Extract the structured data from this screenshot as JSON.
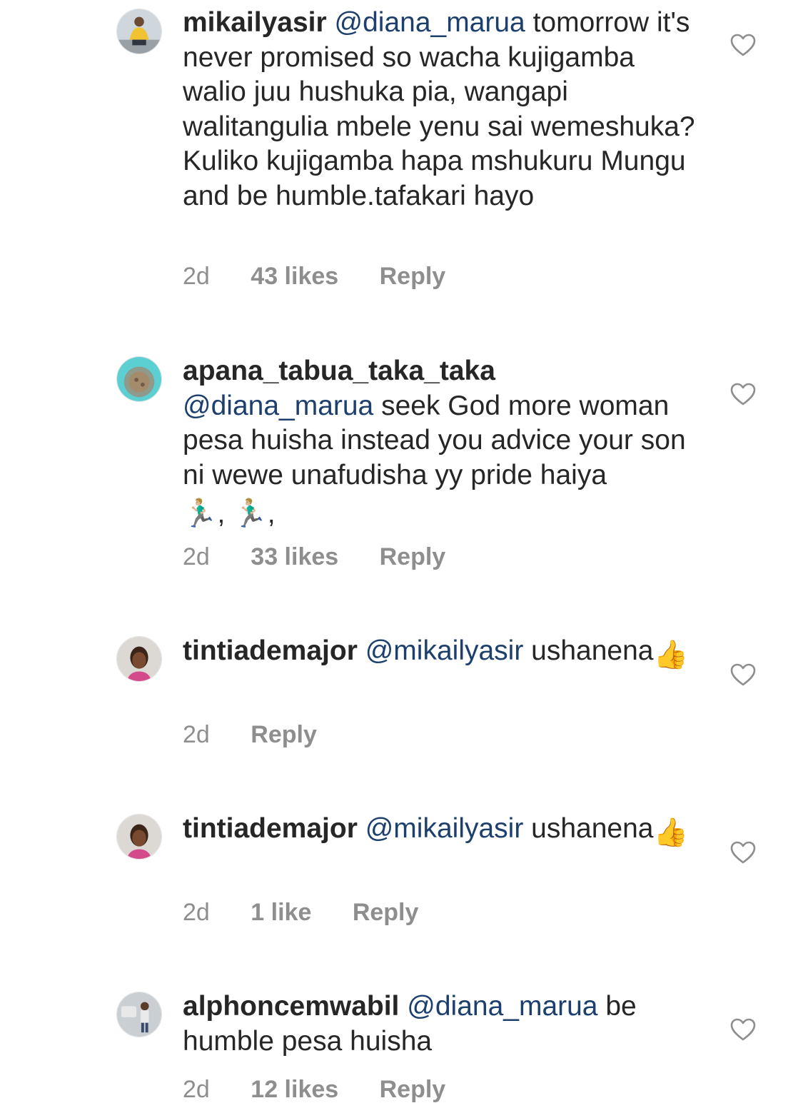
{
  "colors": {
    "text": "#262626",
    "mention": "#1c3f6e",
    "meta": "#8e8e8e"
  },
  "comments": [
    {
      "username": "mikailyasir",
      "mention": "@diana_marua",
      "text_after": " tomorrow it's never promised so wacha kujigamba walio juu hushuka pia, wangapi walitangulia mbele yenu sai wemeshuka? Kuliko kujigamba hapa  mshukuru Mungu and be humble.tafakari hayo",
      "time": "2d",
      "likes": "43 likes",
      "reply": "Reply",
      "avatar_icon": "profile-photo"
    },
    {
      "username": "apana_tabua_taka_taka",
      "mention": "@diana_marua",
      "text_after": " seek God more woman pesa huisha instead you advice your son ni wewe unafudisha yy pride haiya",
      "emoji": "🏃🏼‍♂️, 🏃🏼‍♂️,",
      "time": "2d",
      "likes": "33 likes",
      "reply": "Reply",
      "avatar_icon": "profile-photo"
    },
    {
      "username": "tintiademajor",
      "mention": "@mikailyasir",
      "text_after": " ushanena",
      "emoji": "👍",
      "time": "2d",
      "reply": "Reply",
      "avatar_icon": "profile-photo"
    },
    {
      "username": "tintiademajor",
      "mention": "@mikailyasir",
      "text_after": " ushanena",
      "emoji": "👍",
      "time": "2d",
      "likes": "1 like",
      "reply": "Reply",
      "avatar_icon": "profile-photo"
    },
    {
      "username": "alphoncemwabil",
      "mention": "@diana_marua",
      "text_after": " be humble pesa huisha",
      "time": "2d",
      "likes": "12 likes",
      "reply": "Reply",
      "avatar_icon": "profile-photo"
    }
  ],
  "like_icon": "heart-outline-icon"
}
